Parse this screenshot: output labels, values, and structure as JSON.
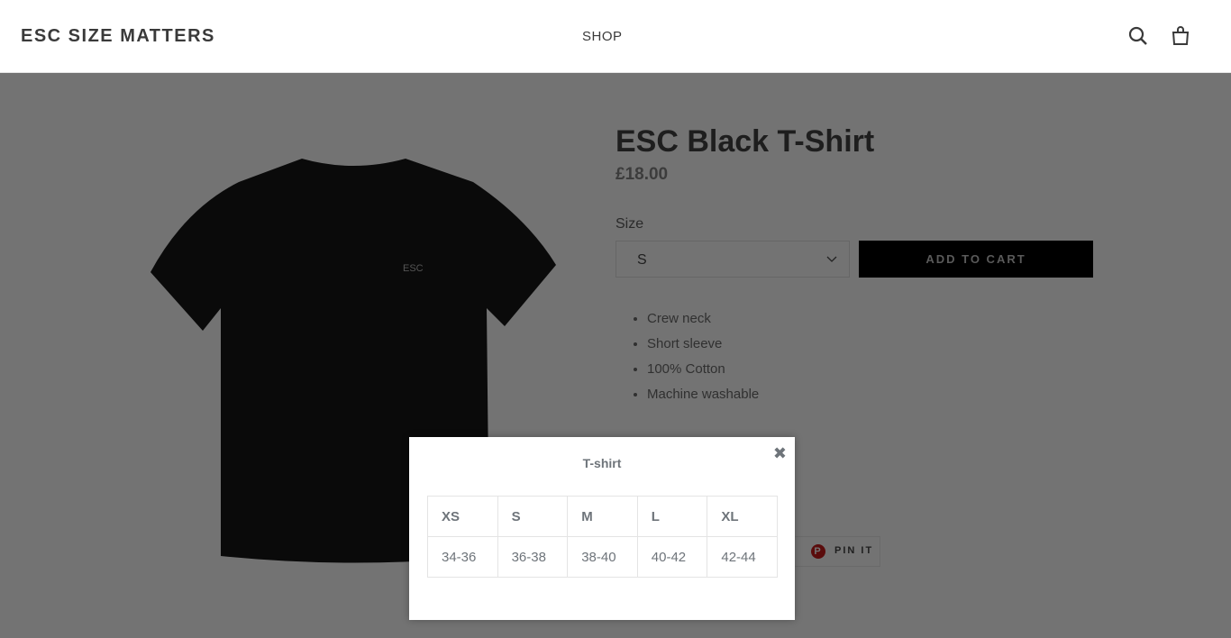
{
  "header": {
    "logo": "ESC SIZE MATTERS",
    "nav": [
      "SHOP"
    ],
    "icons": [
      "search-icon",
      "cart-icon"
    ]
  },
  "product": {
    "title": "ESC Black T-Shirt",
    "price": "£18.00",
    "shirt_print": "ESC",
    "size_label": "Size",
    "size_value": "S",
    "add_to_cart": "ADD TO CART",
    "features": [
      "Crew neck",
      "Short sleeve",
      "100% Cotton",
      "Machine washable"
    ],
    "pin_label": "PIN IT"
  },
  "modal": {
    "title": "T-shirt",
    "close": "✖",
    "headers": [
      "XS",
      "S",
      "M",
      "L",
      "XL"
    ],
    "values": [
      "34-36",
      "36-38",
      "38-40",
      "40-42",
      "42-44"
    ]
  },
  "colors": {
    "overlay": "#737373",
    "button": "#000000",
    "pinterest": "#bd081c"
  }
}
